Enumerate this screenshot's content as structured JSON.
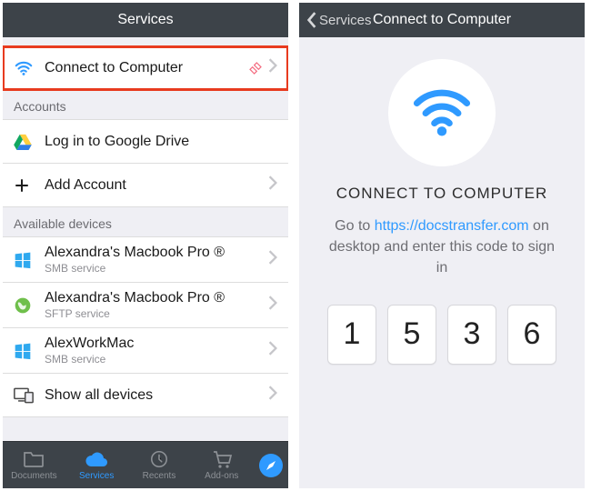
{
  "left": {
    "header_title": "Services",
    "connect_row": "Connect to Computer",
    "section_accounts": "Accounts",
    "google_drive": "Log in to Google Drive",
    "add_account": "Add Account",
    "section_devices": "Available devices",
    "devices": [
      {
        "name": "Alexandra's Macbook Pro ®",
        "service": "SMB service",
        "kind": "windows"
      },
      {
        "name": "Alexandra's Macbook Pro ®",
        "service": "SFTP service",
        "kind": "globe"
      },
      {
        "name": "AlexWorkMac",
        "service": "SMB service",
        "kind": "windows"
      }
    ],
    "show_all": "Show all devices",
    "tabs": {
      "documents": "Documents",
      "services": "Services",
      "recents": "Recents",
      "addons": "Add-ons"
    }
  },
  "right": {
    "back_label": "Services",
    "header_title": "Connect to Computer",
    "heading": "Connect to Computer",
    "instruction_prefix": "Go to ",
    "instruction_url": "https://docstransfer.com",
    "instruction_suffix": " on desktop and enter this code to sign in",
    "code": [
      "1",
      "5",
      "3",
      "6"
    ]
  },
  "colors": {
    "accent": "#2f9aff",
    "highlight": "#e83b1f"
  }
}
